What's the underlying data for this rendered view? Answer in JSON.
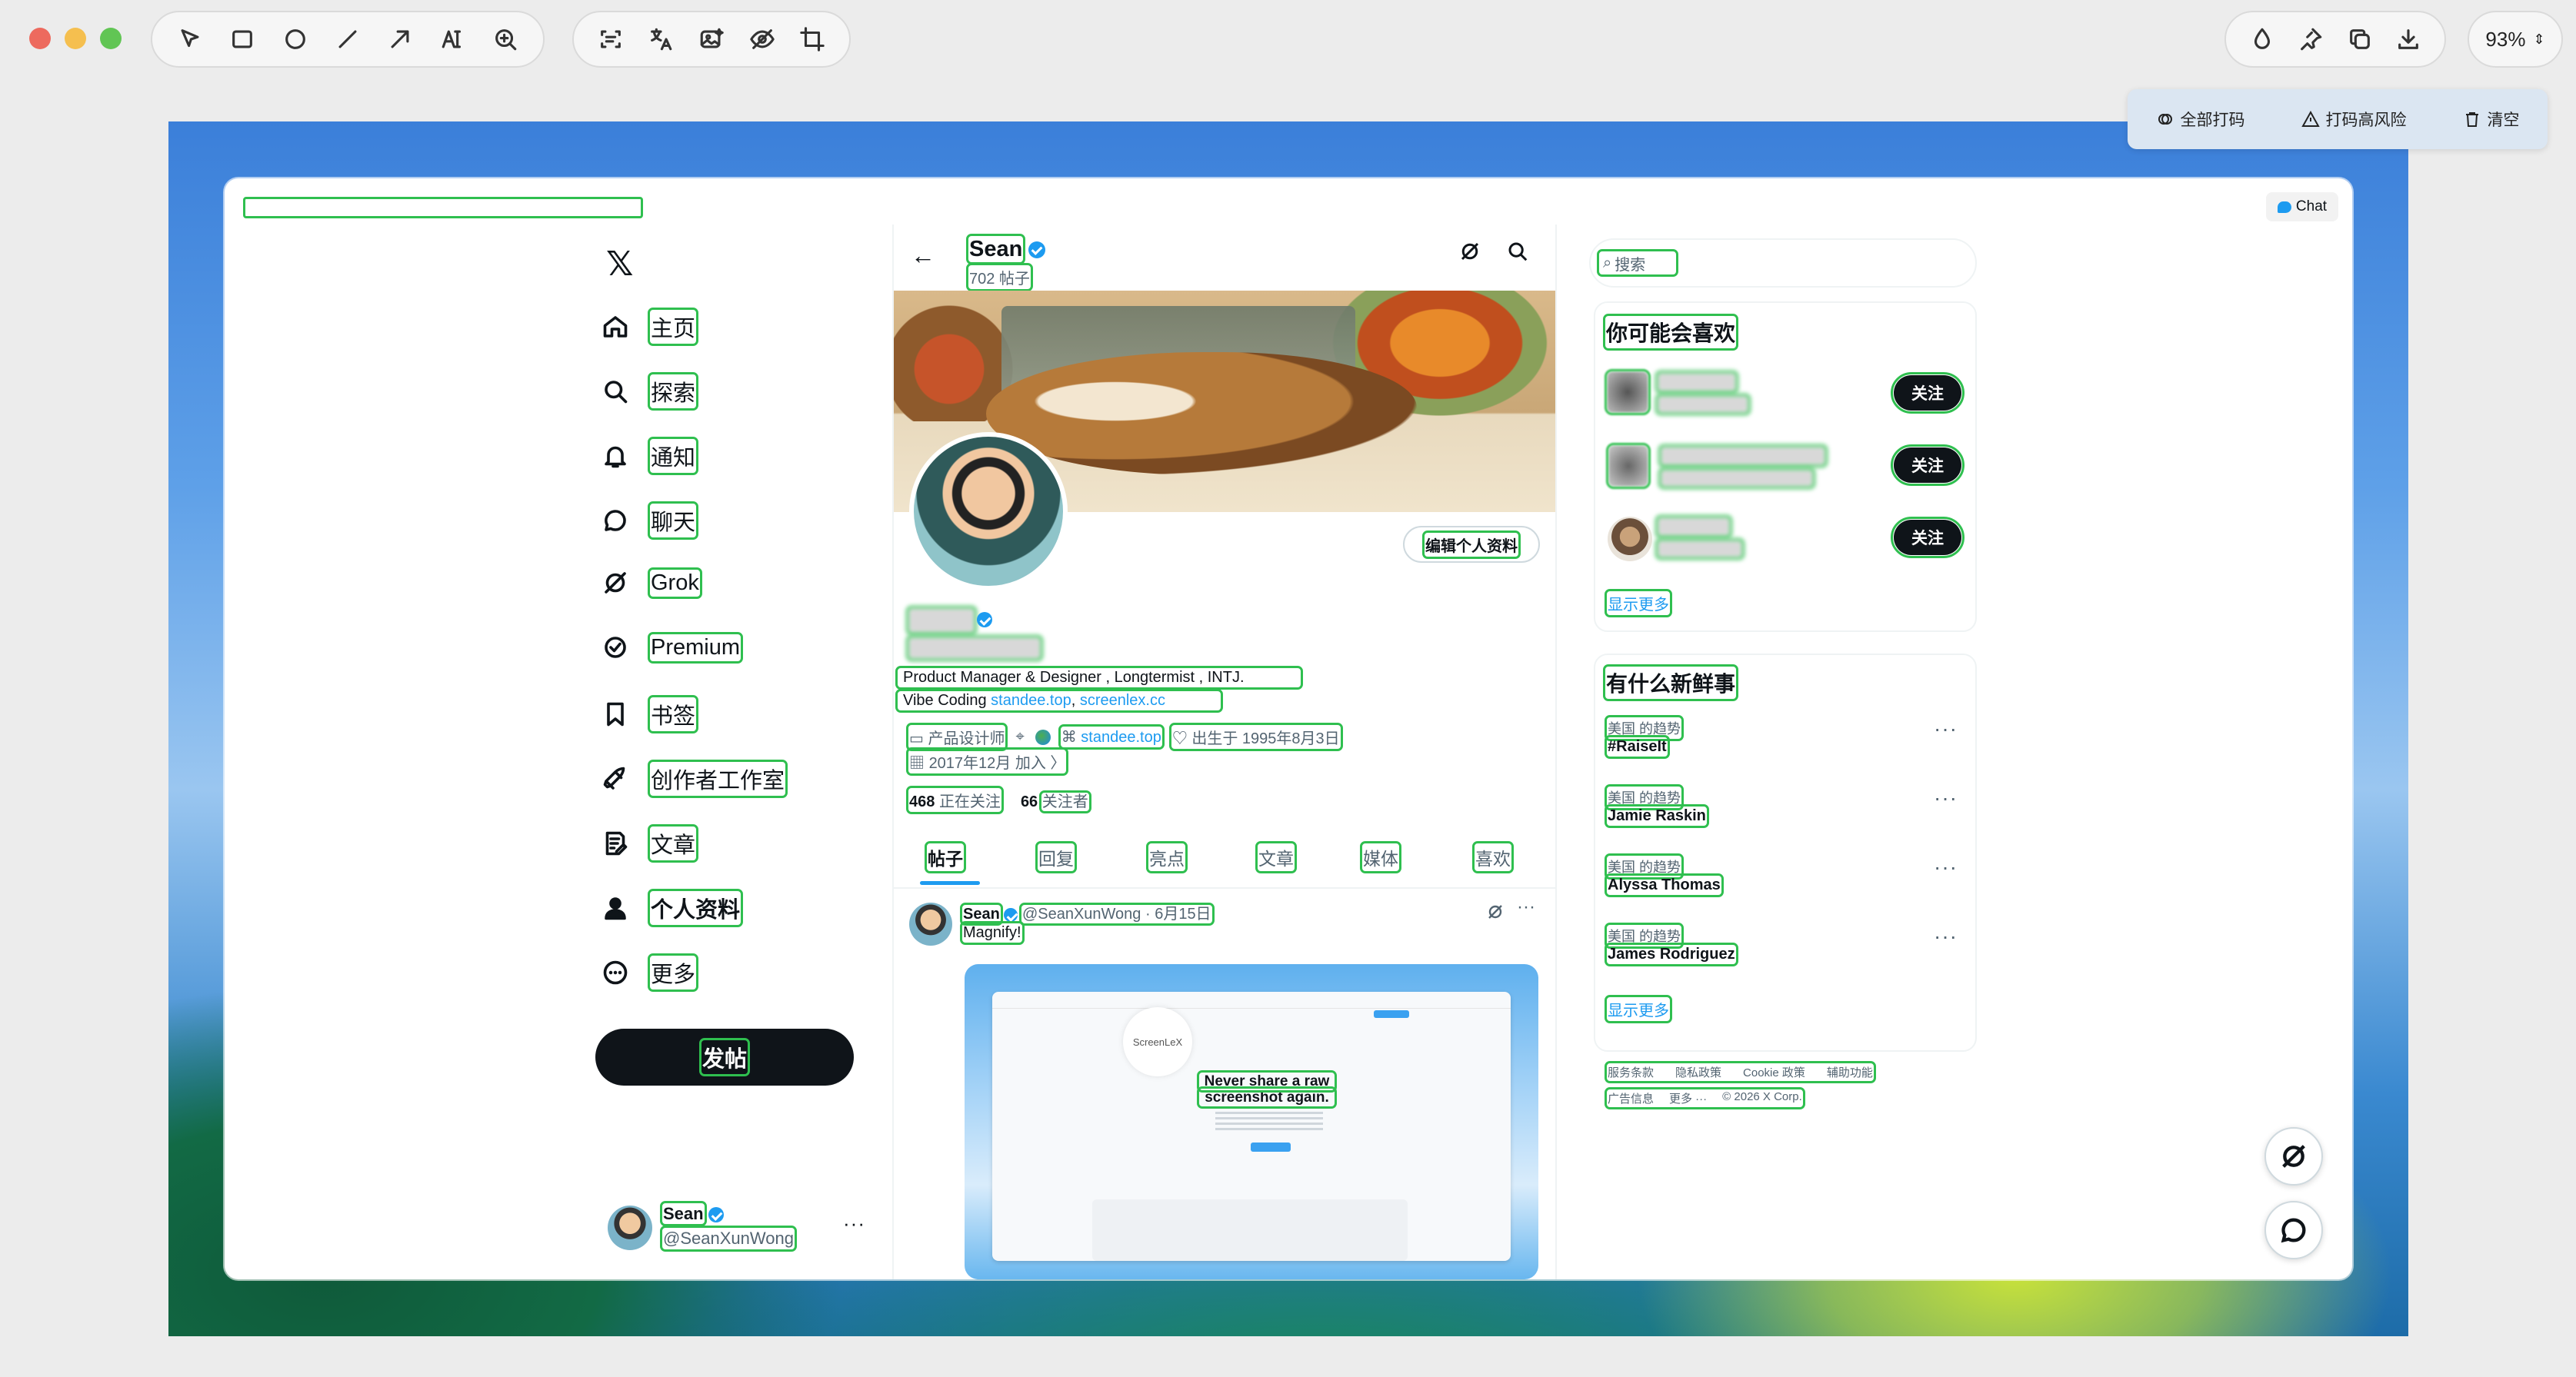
{
  "toolbar": {
    "zoom": "93%",
    "mask": {
      "all": "全部打码",
      "risk": "打码高风险",
      "clear": "清空"
    }
  },
  "browser": {
    "chat": "Chat"
  },
  "nav": {
    "items": [
      "主页",
      "探索",
      "通知",
      "聊天",
      "Grok",
      "Premium",
      "书签",
      "创作者工作室",
      "文章",
      "个人资料",
      "更多"
    ],
    "post": "发帖",
    "account": {
      "name": "Sean",
      "handle": "@SeanXunWong"
    }
  },
  "profile": {
    "name": "Sean",
    "posts_count": "702 帖子",
    "edit": "编辑个人资料",
    "bio_line1": "Product Manager & Designer , Longtermist , INTJ.",
    "bio_line2_prefix": "Vibe Coding ",
    "bio_link1": "standee.top",
    "bio_sep": ", ",
    "bio_link2": "screenlex.cc",
    "job": "产品设计师",
    "website": "standee.top",
    "born": "出生于 1995年8月3日",
    "joined": "2017年12月 加入",
    "following_num": "468",
    "following_label": "正在关注",
    "followers_num": "66",
    "followers_label": "关注者",
    "tabs": [
      "帖子",
      "回复",
      "亮点",
      "文章",
      "媒体",
      "喜欢"
    ]
  },
  "post": {
    "name": "Sean",
    "meta": "@SeanXunWong · 6月15日",
    "text": "Magnify!",
    "image_logo": "ScreenLeX",
    "image_headline1": "Never share a raw",
    "image_headline2": "screenshot again."
  },
  "right": {
    "search_placeholder": "搜索",
    "suggest_title": "你可能会喜欢",
    "follow": "关注",
    "show_more": "显示更多",
    "trends_title": "有什么新鲜事",
    "trends": [
      {
        "context": "美国 的趋势",
        "name": "#RaiseIt"
      },
      {
        "context": "美国 的趋势",
        "name": "Jamie Raskin"
      },
      {
        "context": "美国 的趋势",
        "name": "Alyssa Thomas"
      },
      {
        "context": "美国 的趋势",
        "name": "James Rodriguez"
      }
    ],
    "trends_more": "显示更多",
    "footer_line1": [
      "服务条款",
      "隐私政策",
      "Cookie 政策",
      "辅助功能"
    ],
    "footer_line2": [
      "广告信息",
      "更多 ···",
      "© 2026 X Corp."
    ]
  }
}
